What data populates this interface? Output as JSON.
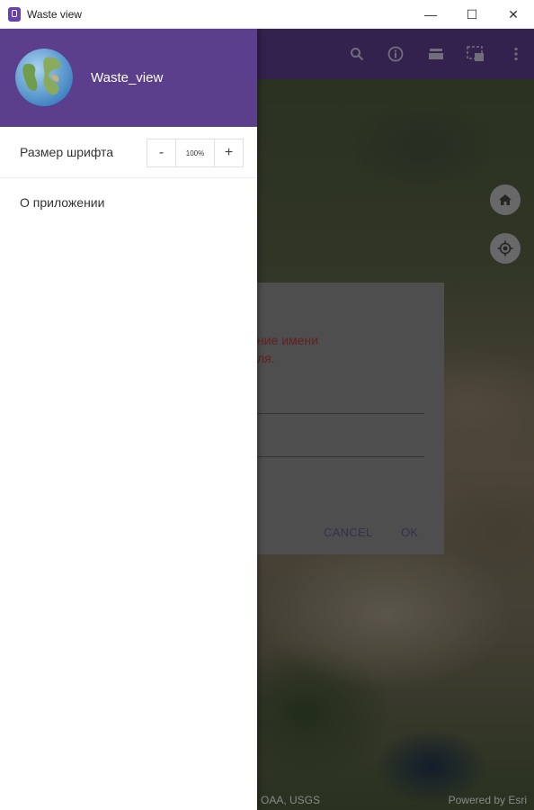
{
  "window": {
    "title": "Waste view",
    "minimize": "—",
    "maximize": "☐",
    "close": "✕"
  },
  "toolbar": {
    "icons": [
      "search-icon",
      "info-icon",
      "layers-icon",
      "screenshot-icon",
      "more-vert-icon"
    ]
  },
  "map": {
    "home_icon": "home-icon",
    "locate_icon": "my-location-icon",
    "attribution_left": "OAA, USGS",
    "attribution_right": "Powered by Esri"
  },
  "dialog": {
    "error_text": "ние имени\nля.",
    "cancel_label": "CANCEL",
    "ok_label": "OK"
  },
  "drawer": {
    "app_name": "Waste_view",
    "font_size_label": "Размер шрифта",
    "decrement_label": "-",
    "increment_label": "+",
    "font_size_value": "100%",
    "about_label": "О приложении"
  },
  "colors": {
    "primary": "#5b3e8c",
    "dialog_error": "#b33a3a"
  }
}
